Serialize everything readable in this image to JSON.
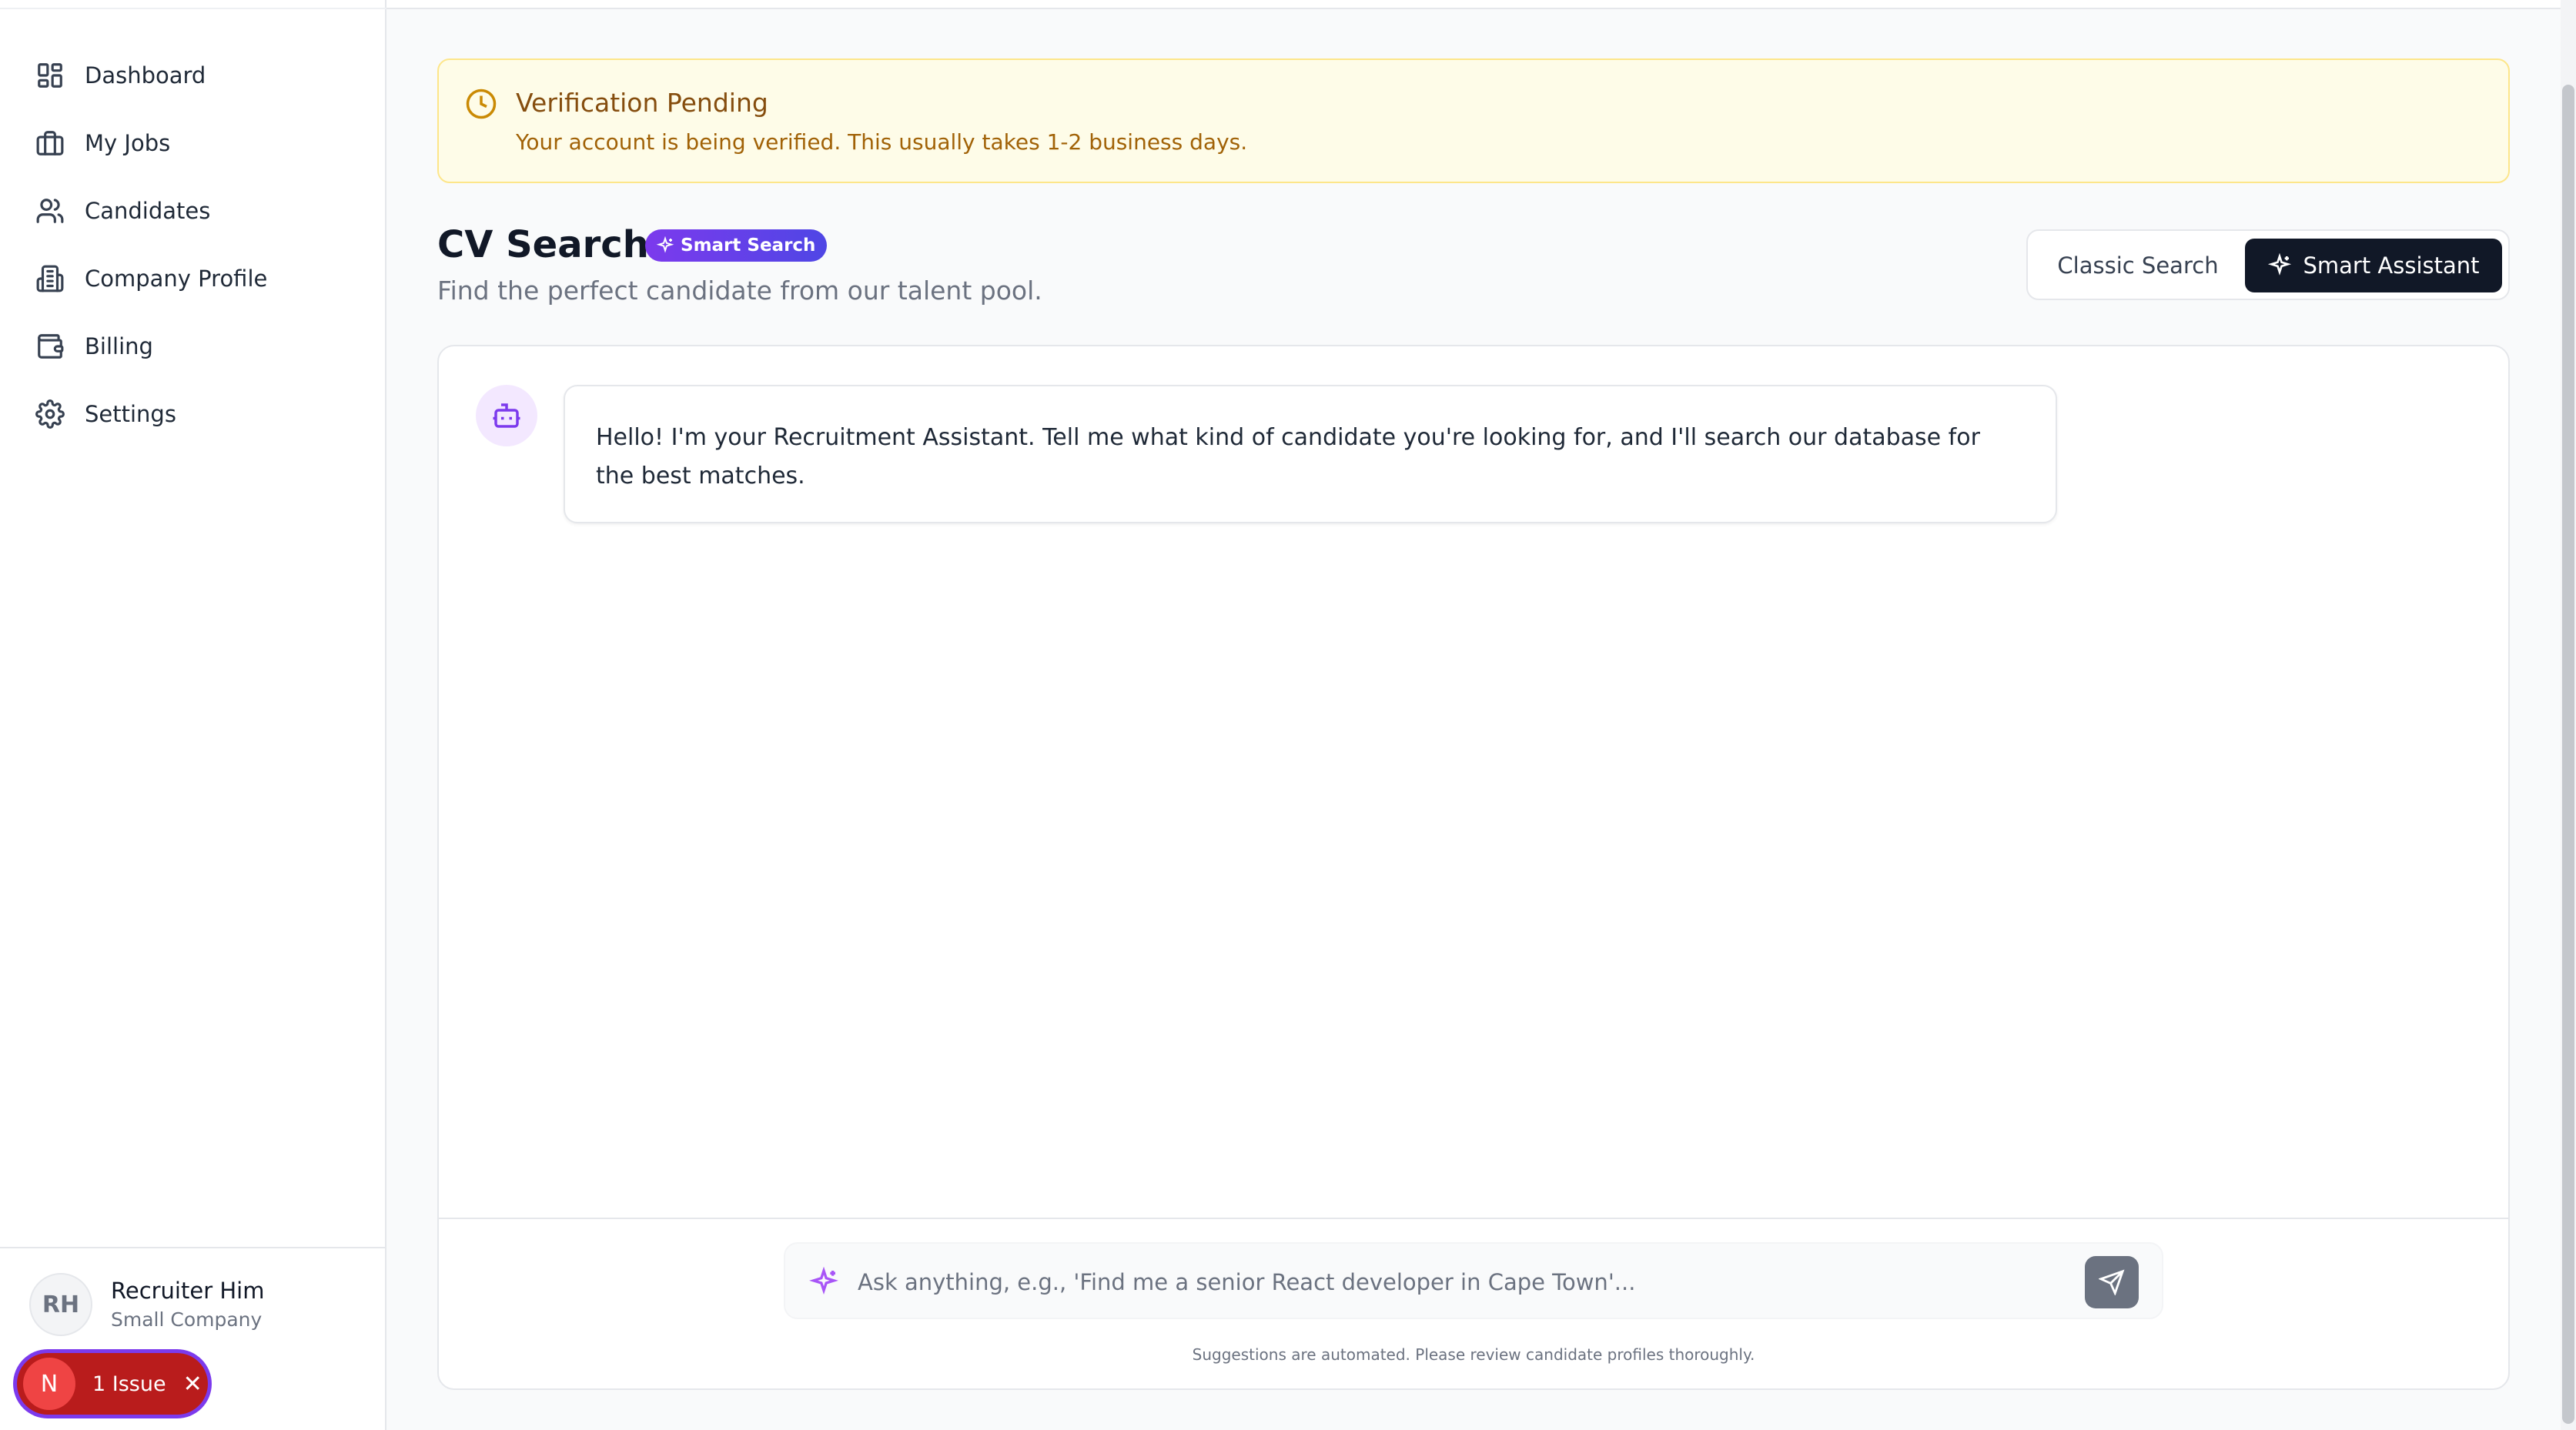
{
  "sidebar": {
    "items": [
      {
        "label": "Dashboard",
        "icon": "layout-dashboard-icon"
      },
      {
        "label": "My Jobs",
        "icon": "briefcase-icon"
      },
      {
        "label": "Candidates",
        "icon": "users-icon"
      },
      {
        "label": "Company Profile",
        "icon": "building-icon"
      },
      {
        "label": "Billing",
        "icon": "wallet-icon"
      },
      {
        "label": "Settings",
        "icon": "gear-icon"
      }
    ],
    "user": {
      "initials": "RH",
      "name": "Recruiter Him",
      "company": "Small Company"
    },
    "issue_badge": {
      "initial": "N",
      "label": "1 Issue"
    }
  },
  "banner": {
    "title": "Verification Pending",
    "text": "Your account is being verified. This usually takes 1-2 business days.",
    "color": "#ca8a04"
  },
  "header": {
    "title": "CV Search",
    "badge": "Smart Search",
    "subtitle": "Find the perfect candidate from our talent pool.",
    "toggle": {
      "classic": "Classic Search",
      "smart": "Smart Assistant",
      "selected": "Smart Assistant"
    }
  },
  "chat": {
    "messages": [
      {
        "role": "assistant",
        "text": "Hello! I'm your Recruitment Assistant. Tell me what kind of candidate you're looking for, and I'll search our database for the best matches."
      }
    ],
    "input_placeholder": "Ask anything, e.g., 'Find me a senior React developer in Cape Town'...",
    "disclaimer": "Suggestions are automated. Please review candidate profiles thoroughly."
  },
  "colors": {
    "accent": "#7c3aed",
    "dark": "#111827",
    "issue": "#b91c1c"
  }
}
